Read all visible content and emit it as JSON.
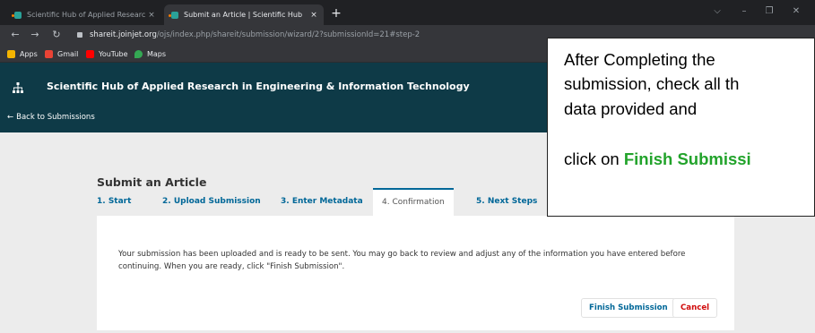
{
  "browser": {
    "tabs": [
      {
        "title": "Scientific Hub of Applied Researc",
        "close": "×"
      },
      {
        "title": "Submit an Article | Scientific Hub",
        "close": "×"
      }
    ],
    "new_tab": "+",
    "window_controls": [
      "⌵",
      "–",
      "❐",
      "✕"
    ],
    "url_host": "shareit.joinjet.org",
    "url_path": "/ojs/index.php/shareit/submission/wizard/2?submissionId=21#step-2",
    "bookmarks": [
      {
        "label": "Apps",
        "icon": "apps-grid-icon",
        "color": "#f4b400"
      },
      {
        "label": "Gmail",
        "icon": "gmail-icon",
        "color": "#ea4335"
      },
      {
        "label": "YouTube",
        "icon": "youtube-icon",
        "color": "#ff0000"
      },
      {
        "label": "Maps",
        "icon": "maps-pin-icon",
        "color": "#34a853"
      }
    ]
  },
  "site": {
    "title": "Scientific Hub of Applied Research in Engineering & Information Technology",
    "back_link": "Back to Submissions",
    "header_color": "#0e3a47",
    "logo_icon": "sitemap-icon"
  },
  "wizard": {
    "heading": "Submit an Article",
    "tabs": [
      "1. Start",
      "2. Upload Submission",
      "3. Enter Metadata",
      "4. Confirmation",
      "5. Next Steps"
    ],
    "active_tab_index": 3,
    "message": "Your submission has been uploaded and is ready to be sent. You may go back to review and adjust any of the information you have entered before continuing. When you are ready, click \"Finish Submission\".",
    "finish_label": "Finish Submission",
    "cancel_label": "Cancel",
    "link_color": "#006798",
    "cancel_color": "#d00a0a"
  },
  "callout": {
    "line1": "After Completing the",
    "line2": "submission, check all th",
    "line3": "data provided and",
    "line4_prefix": "click on ",
    "line4_emph": "Finish Submissi",
    "accent_color": "#22a32b"
  }
}
